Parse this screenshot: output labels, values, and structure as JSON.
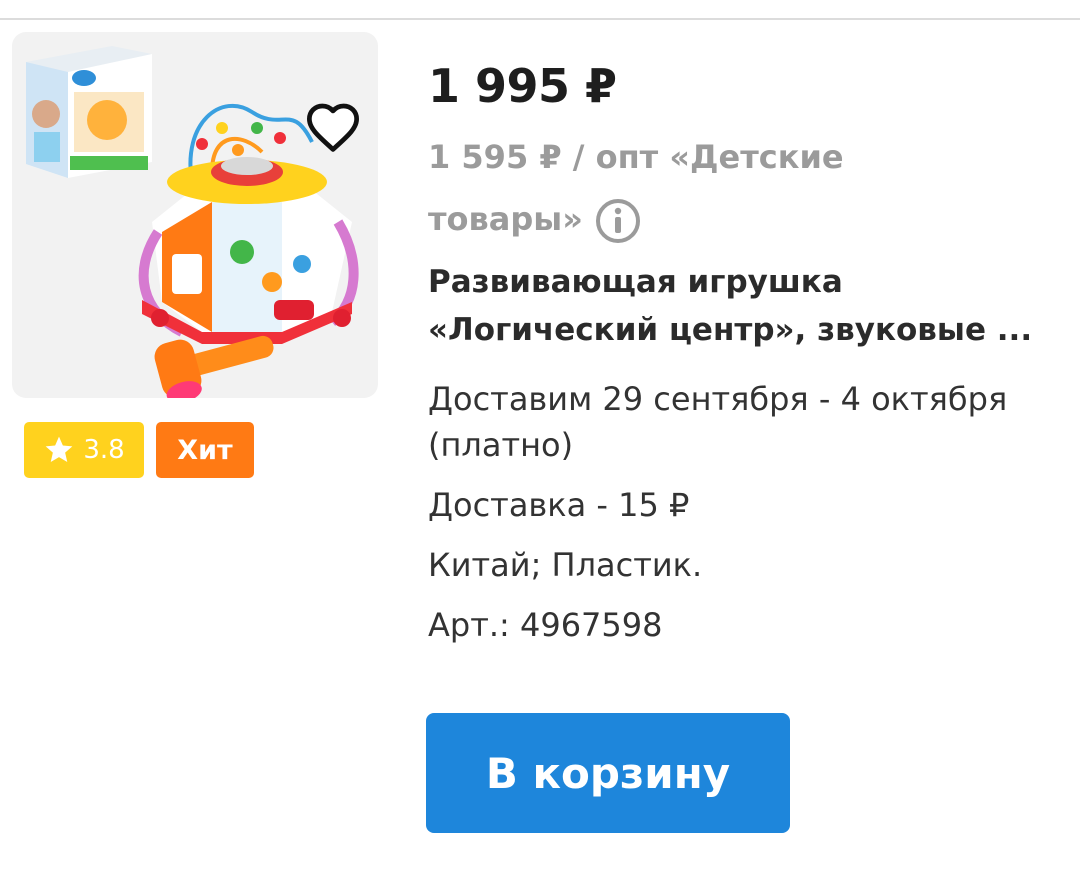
{
  "product": {
    "price": "1 995 ₽",
    "wholesale_price": "1 595 ₽ / опт «Детские товары»",
    "title_line1": "Развивающая игрушка",
    "title_line2": "«Логический центр», звуковые ...",
    "rating": "3.8",
    "badge": "Хит",
    "delivery_date": "Доставим 29 сентября - 4 октября (платно)",
    "delivery_cost": "Доставка - 15 ₽",
    "origin_material": "Китай; Пластик.",
    "article": "Арт.: 4967598",
    "cart_button_label": "В корзину"
  },
  "icons": {
    "favorite": "heart-outline-icon",
    "rating": "star-icon",
    "info": "info-circle-icon"
  },
  "colors": {
    "accent_blue": "#1e86db",
    "rating_badge": "#ffd21e",
    "hit_badge": "#ff7a14",
    "muted_text": "#9b9b9b"
  }
}
